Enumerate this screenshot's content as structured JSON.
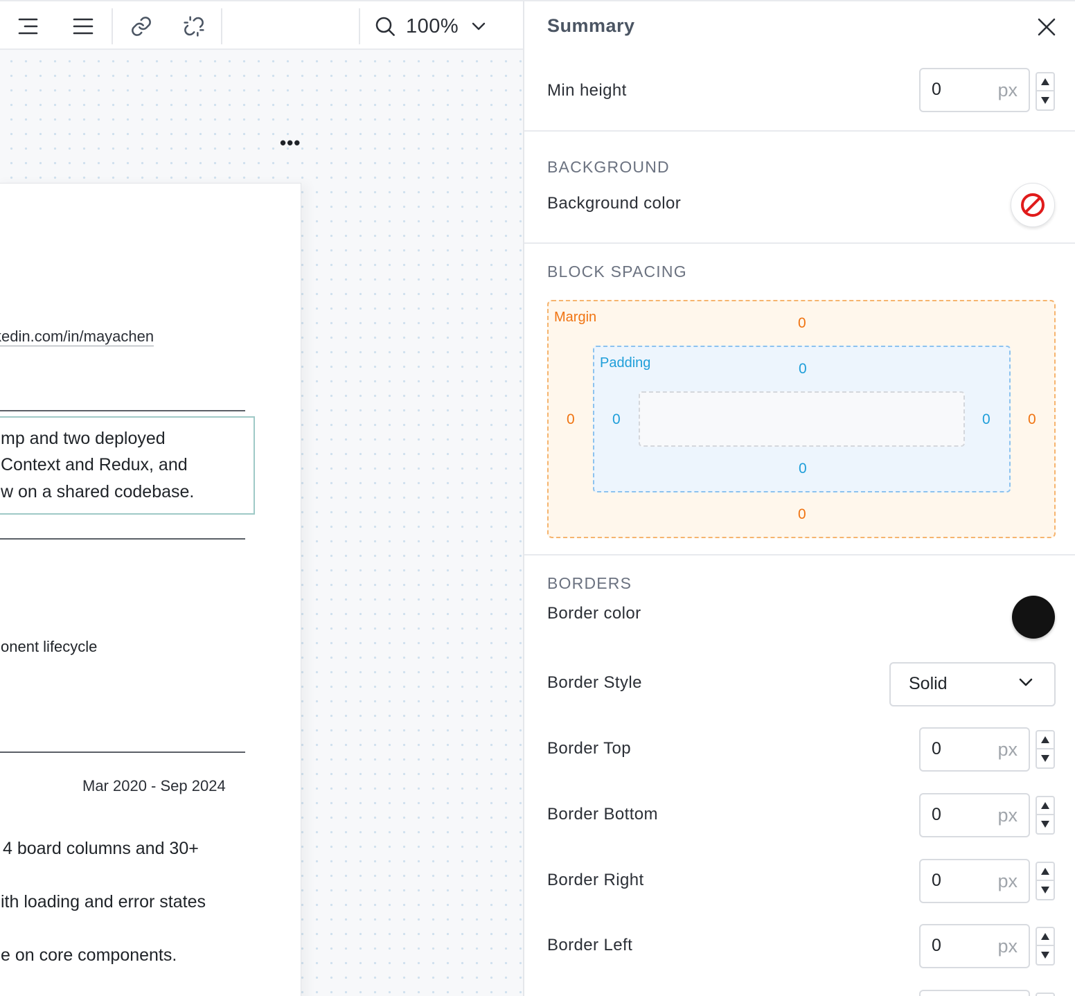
{
  "toolbar": {
    "icons": [
      "align-right-icon",
      "align-justify-icon",
      "link-icon",
      "unlink-icon",
      "zoom-icon",
      "chevron-down-icon"
    ],
    "zoom": "100%"
  },
  "canvas": {
    "more_menu": "•••",
    "document": {
      "link": "kedin.com/in/mayachen",
      "selected_lines": [
        "mp and two deployed",
        "Context and Redux, and",
        "w on a shared codebase."
      ],
      "line_component": "onent lifecycle",
      "date_range": "Mar 2020 - Sep 2024",
      "bullets": [
        "4 board columns and 30+",
        "ith loading and error states",
        "e on core components."
      ]
    }
  },
  "panel": {
    "title": "Summary",
    "min_height": {
      "label": "Min height",
      "value": "0",
      "unit": "px"
    },
    "background": {
      "section": "BACKGROUND",
      "color_label": "Background color",
      "color_icon": "no-color-icon",
      "color_value": "none"
    },
    "block_spacing": {
      "section": "BLOCK SPACING",
      "margin_label": "Margin",
      "padding_label": "Padding",
      "margin": {
        "top": "0",
        "right": "0",
        "bottom": "0",
        "left": "0"
      },
      "padding": {
        "top": "0",
        "right": "0",
        "bottom": "0",
        "left": "0"
      }
    },
    "borders": {
      "section": "BORDERS",
      "color_label": "Border color",
      "color_value": "#121212",
      "style_label": "Border Style",
      "style_value": "Solid",
      "top": {
        "label": "Border Top",
        "value": "0",
        "unit": "px"
      },
      "bottom": {
        "label": "Border Bottom",
        "value": "0",
        "unit": "px"
      },
      "right": {
        "label": "Border Right",
        "value": "0",
        "unit": "px"
      },
      "left": {
        "label": "Border Left",
        "value": "0",
        "unit": "px"
      }
    },
    "stepper": {
      "up": "▲",
      "down": "▼"
    }
  }
}
